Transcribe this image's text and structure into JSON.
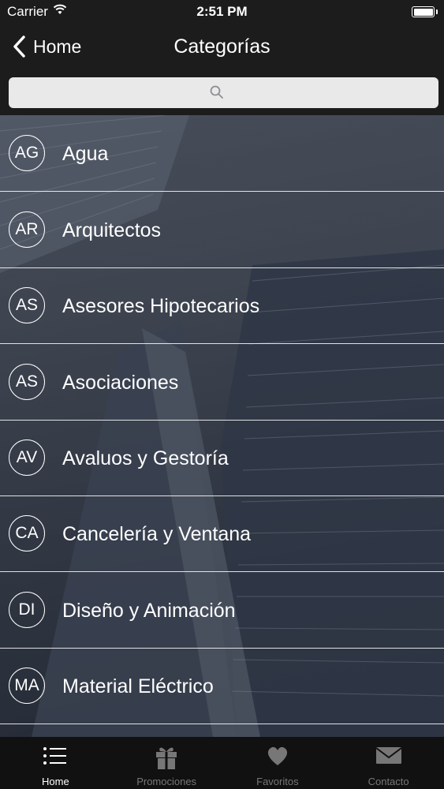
{
  "status_bar": {
    "carrier": "Carrier",
    "time": "2:51 PM"
  },
  "nav": {
    "back_label": "Home",
    "title": "Categorías"
  },
  "search": {
    "placeholder": ""
  },
  "categories": [
    {
      "initials": "AG",
      "label": "Agua"
    },
    {
      "initials": "AR",
      "label": "Arquitectos"
    },
    {
      "initials": "AS",
      "label": "Asesores Hipotecarios"
    },
    {
      "initials": "AS",
      "label": "Asociaciones"
    },
    {
      "initials": "AV",
      "label": "Avaluos y Gestoría"
    },
    {
      "initials": "CA",
      "label": "Cancelería y Ventana"
    },
    {
      "initials": "DI",
      "label": "Diseño y Animación"
    },
    {
      "initials": "MA",
      "label": "Material Eléctrico"
    }
  ],
  "tabs": [
    {
      "label": "Home",
      "icon": "list-icon",
      "active": true
    },
    {
      "label": "Promociones",
      "icon": "gift-icon",
      "active": false
    },
    {
      "label": "Favoritos",
      "icon": "heart-icon",
      "active": false
    },
    {
      "label": "Contacto",
      "icon": "envelope-icon",
      "active": false
    }
  ],
  "colors": {
    "bar_background": "#1c1c1c",
    "tab_bar_background": "#111111",
    "inactive_tab": "#777777"
  }
}
